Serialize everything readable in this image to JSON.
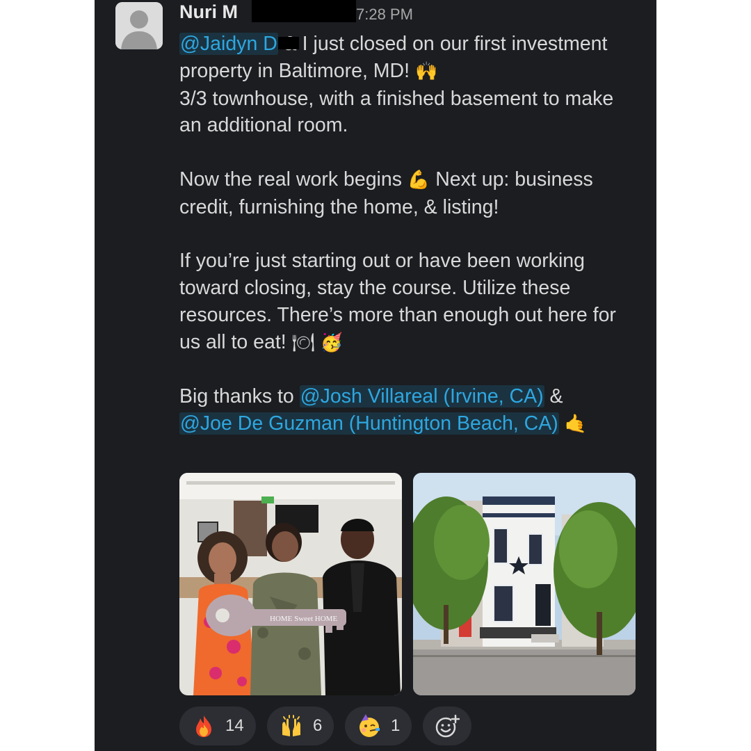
{
  "message": {
    "author_visible": "Nuri M",
    "timestamp_visible": "7:28 PM",
    "mention_1": "@Jaidyn D",
    "line1_rest": " & I just closed on our first investment property in Baltimore, MD! ",
    "line1_emoji": "raised-hands-emoji",
    "line2": "3/3 townhouse, with a finished basement to make an additional room.",
    "para2_a": "Now the real work begins ",
    "para2_emoji": "flexed-biceps-emoji",
    "para2_b": " Next up: business credit, furnishing the home, & listing!",
    "para3": "If you’re just starting out or have been working toward closing, stay the course. Utilize these resources. There’s more than enough out here for us all to eat! ",
    "para3_emojis": [
      "fork-knife-plate-emoji",
      "partying-face-emoji"
    ],
    "thanks_prefix": "Big thanks to ",
    "mention_2": "@Josh Villareal (Irvine, CA)",
    "thanks_and": " &",
    "mention_3": "@Joe De Guzman (Huntington Beach, CA)",
    "thanks_emoji": "call-me-hand-emoji"
  },
  "attachments": [
    {
      "name": "photo-three-people-key",
      "key_text": "HOME Sweet HOME"
    },
    {
      "name": "photo-townhouse"
    }
  ],
  "reactions": [
    {
      "emoji": "fire-emoji",
      "count": "14"
    },
    {
      "emoji": "raised-hands-emoji",
      "count": "6"
    },
    {
      "emoji": "partying-face-emoji",
      "count": "1"
    }
  ],
  "add_reaction_icon": "add-reaction-icon",
  "colors": {
    "background": "#1b1d21",
    "mention": "#2ea7e0",
    "text": "#d9d9d9",
    "reaction_pill": "#2c2e33"
  }
}
